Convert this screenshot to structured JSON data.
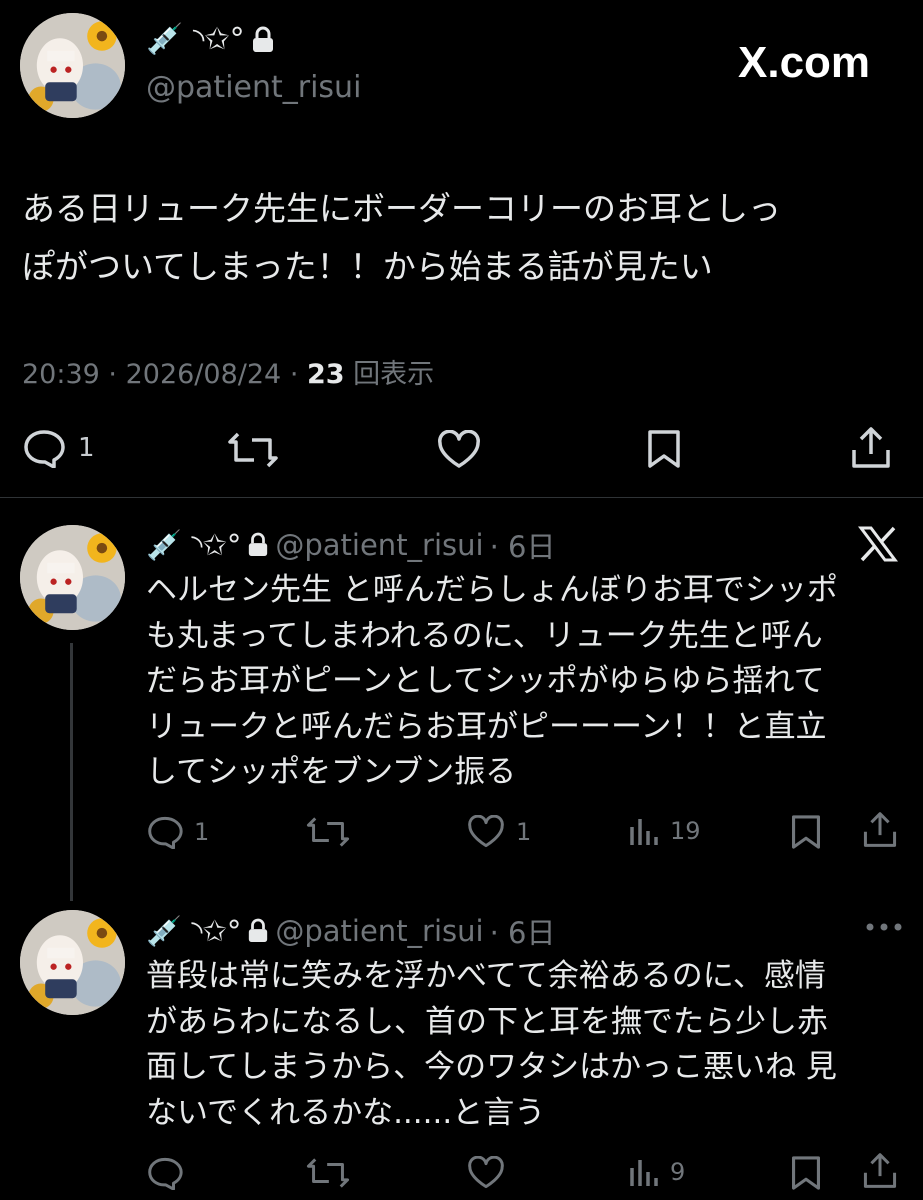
{
  "watermark": {
    "text": "X.com"
  },
  "main_post": {
    "display_name": "💉 ◝✩°",
    "handle": "@patient_risui",
    "text_lines": [
      "ある日リューク先生にボーダーコリーのお耳としっ",
      "ぽがついてしまった！！から始まる話が見たい"
    ],
    "time": "20:39",
    "separator": "·",
    "date": "2026/08/24",
    "views_count": "23",
    "views_label": "回表示",
    "actions": {
      "reply_count": "1"
    }
  },
  "replies": [
    {
      "display_name": "💉 ◝✩°",
      "handle": "@patient_risui",
      "age": "· 6日",
      "text_lines": [
        "ヘルセン先生 と呼んだらしょんぼりお耳でシッポ",
        "も丸まってしまわれるのに、リューク先生と呼ん",
        "だらお耳がピーンとしてシッポがゆらゆら揺れて",
        "リュークと呼んだらお耳がピーーーン！！と直立",
        "してシッポをブンブン振る"
      ],
      "actions": {
        "reply_count": "1",
        "like_count": "1",
        "view_count": "19"
      },
      "corner_icon": "x-logo-icon"
    },
    {
      "display_name": "💉 ◝✩°",
      "handle": "@patient_risui",
      "age": "· 6日",
      "text_lines": [
        "普段は常に笑みを浮かべてて余裕あるのに、感情",
        "があらわになるし、首の下と耳を撫でたら少し赤",
        "面してしまうから、今のワタシはかっこ悪いね 見",
        "ないでくれるかな......と言う"
      ],
      "actions": {
        "view_count": "9"
      },
      "corner_icon": "more-icon"
    }
  ]
}
